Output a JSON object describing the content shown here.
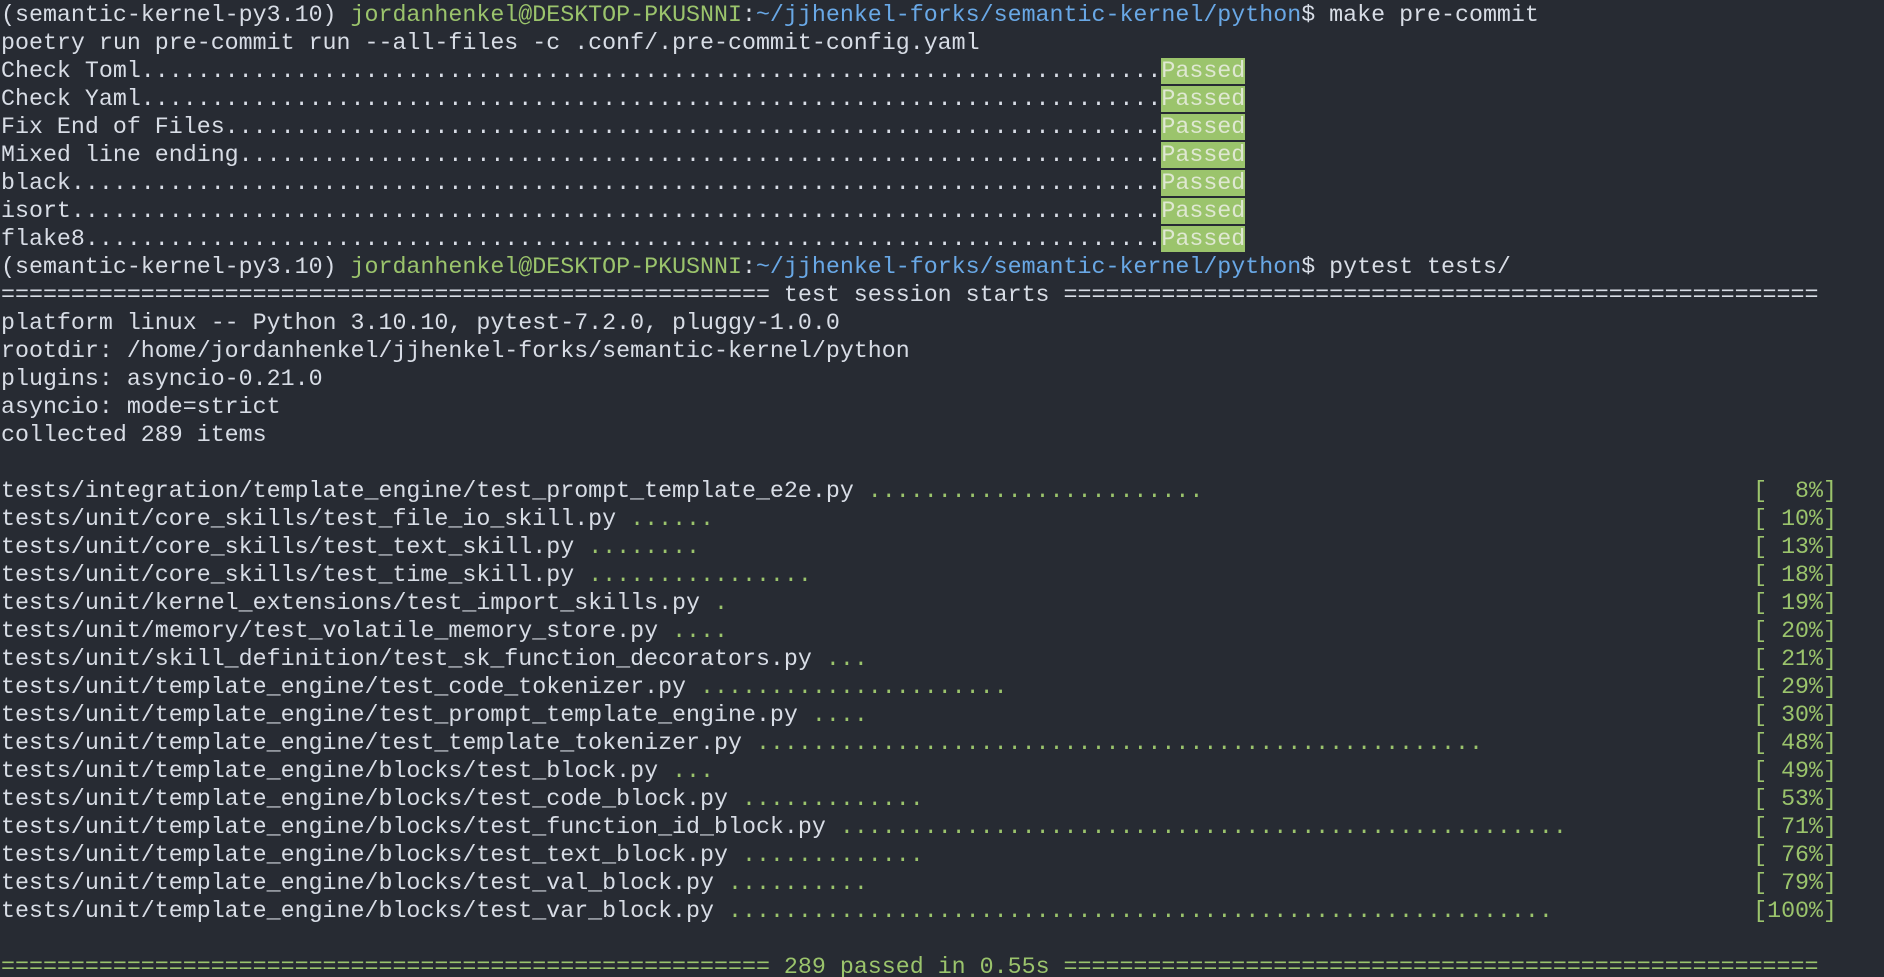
{
  "prompts": [
    {
      "venv": "(semantic-kernel-py3.10)",
      "user": "jordanhenkel@DESKTOP-PKUSNNI",
      "colon": ":",
      "path": "~/jjhenkel-forks/semantic-kernel/python",
      "dollar": "$",
      "command": "make pre-commit"
    },
    {
      "venv": "(semantic-kernel-py3.10)",
      "user": "jordanhenkel@DESKTOP-PKUSNNI",
      "colon": ":",
      "path": "~/jjhenkel-forks/semantic-kernel/python",
      "dollar": "$",
      "command": "pytest tests/"
    }
  ],
  "precommit": {
    "run_command": "poetry run pre-commit run --all-files -c .conf/.pre-commit-config.yaml",
    "status_label": "Passed",
    "hooks": [
      "Check Toml.........................................................................",
      "Check Yaml.........................................................................",
      "Fix End of Files...................................................................",
      "Mixed line ending..................................................................",
      "black..............................................................................",
      "isort..............................................................................",
      "flake8............................................................................."
    ]
  },
  "pytest": {
    "session_header": "======================================================= test session starts ======================================================",
    "platform": "platform linux -- Python 3.10.10, pytest-7.2.0, pluggy-1.0.0",
    "rootdir": "rootdir: /home/jordanhenkel/jjhenkel-forks/semantic-kernel/python",
    "plugins": "plugins: asyncio-0.21.0",
    "asyncio_mode": "asyncio: mode=strict",
    "collected": "collected 289 items",
    "results": [
      {
        "file": "tests/integration/template_engine/test_prompt_template_e2e.py",
        "dots": "........................",
        "pct": "[  8%]"
      },
      {
        "file": "tests/unit/core_skills/test_file_io_skill.py",
        "dots": "......",
        "pct": "[ 10%]"
      },
      {
        "file": "tests/unit/core_skills/test_text_skill.py",
        "dots": "........",
        "pct": "[ 13%]"
      },
      {
        "file": "tests/unit/core_skills/test_time_skill.py",
        "dots": "................",
        "pct": "[ 18%]"
      },
      {
        "file": "tests/unit/kernel_extensions/test_import_skills.py",
        "dots": ".",
        "pct": "[ 19%]"
      },
      {
        "file": "tests/unit/memory/test_volatile_memory_store.py",
        "dots": "....",
        "pct": "[ 20%]"
      },
      {
        "file": "tests/unit/skill_definition/test_sk_function_decorators.py",
        "dots": "...",
        "pct": "[ 21%]"
      },
      {
        "file": "tests/unit/template_engine/test_code_tokenizer.py",
        "dots": "......................",
        "pct": "[ 29%]"
      },
      {
        "file": "tests/unit/template_engine/test_prompt_template_engine.py",
        "dots": "....",
        "pct": "[ 30%]"
      },
      {
        "file": "tests/unit/template_engine/test_template_tokenizer.py",
        "dots": "....................................................",
        "pct": "[ 48%]"
      },
      {
        "file": "tests/unit/template_engine/blocks/test_block.py",
        "dots": "...",
        "pct": "[ 49%]"
      },
      {
        "file": "tests/unit/template_engine/blocks/test_code_block.py",
        "dots": ".............",
        "pct": "[ 53%]"
      },
      {
        "file": "tests/unit/template_engine/blocks/test_function_id_block.py",
        "dots": "....................................................",
        "pct": "[ 71%]"
      },
      {
        "file": "tests/unit/template_engine/blocks/test_text_block.py",
        "dots": ".............",
        "pct": "[ 76%]"
      },
      {
        "file": "tests/unit/template_engine/blocks/test_val_block.py",
        "dots": "..........",
        "pct": "[ 79%]"
      },
      {
        "file": "tests/unit/template_engine/blocks/test_var_block.py",
        "dots": "...........................................................",
        "pct": "[100%]"
      }
    ],
    "summary_left": "=======================================================",
    "summary_text": " 289 passed in 0.55s ",
    "summary_right": "======================================================"
  },
  "colors": {
    "background": "#272b33",
    "foreground": "#d8dde6",
    "green": "#9bc46c",
    "blue": "#69a8e6"
  }
}
